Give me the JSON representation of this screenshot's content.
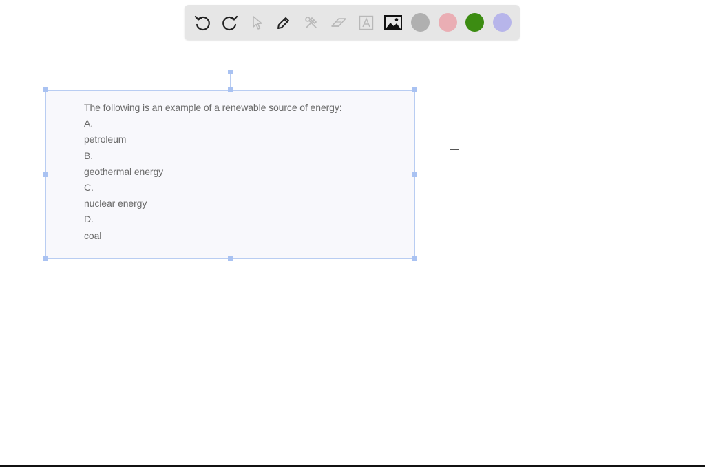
{
  "toolbar": {
    "tools": [
      {
        "name": "undo-icon"
      },
      {
        "name": "redo-icon"
      },
      {
        "name": "select-pointer-icon"
      },
      {
        "name": "pen-icon"
      },
      {
        "name": "tools-icon"
      },
      {
        "name": "eraser-icon"
      },
      {
        "name": "text-box-icon"
      },
      {
        "name": "image-icon"
      }
    ],
    "colors": {
      "gray": "#b0b0b0",
      "pink": "#eaaeb4",
      "green": "#3c8c12",
      "lavender": "#b7b5ea"
    }
  },
  "question": {
    "prompt": "The following is an example of a renewable source of energy:",
    "options": [
      {
        "letter": "A.",
        "text": "petroleum"
      },
      {
        "letter": "B.",
        "text": "geothermal energy"
      },
      {
        "letter": "C.",
        "text": "nuclear energy"
      },
      {
        "letter": "D.",
        "text": "coal"
      }
    ]
  }
}
